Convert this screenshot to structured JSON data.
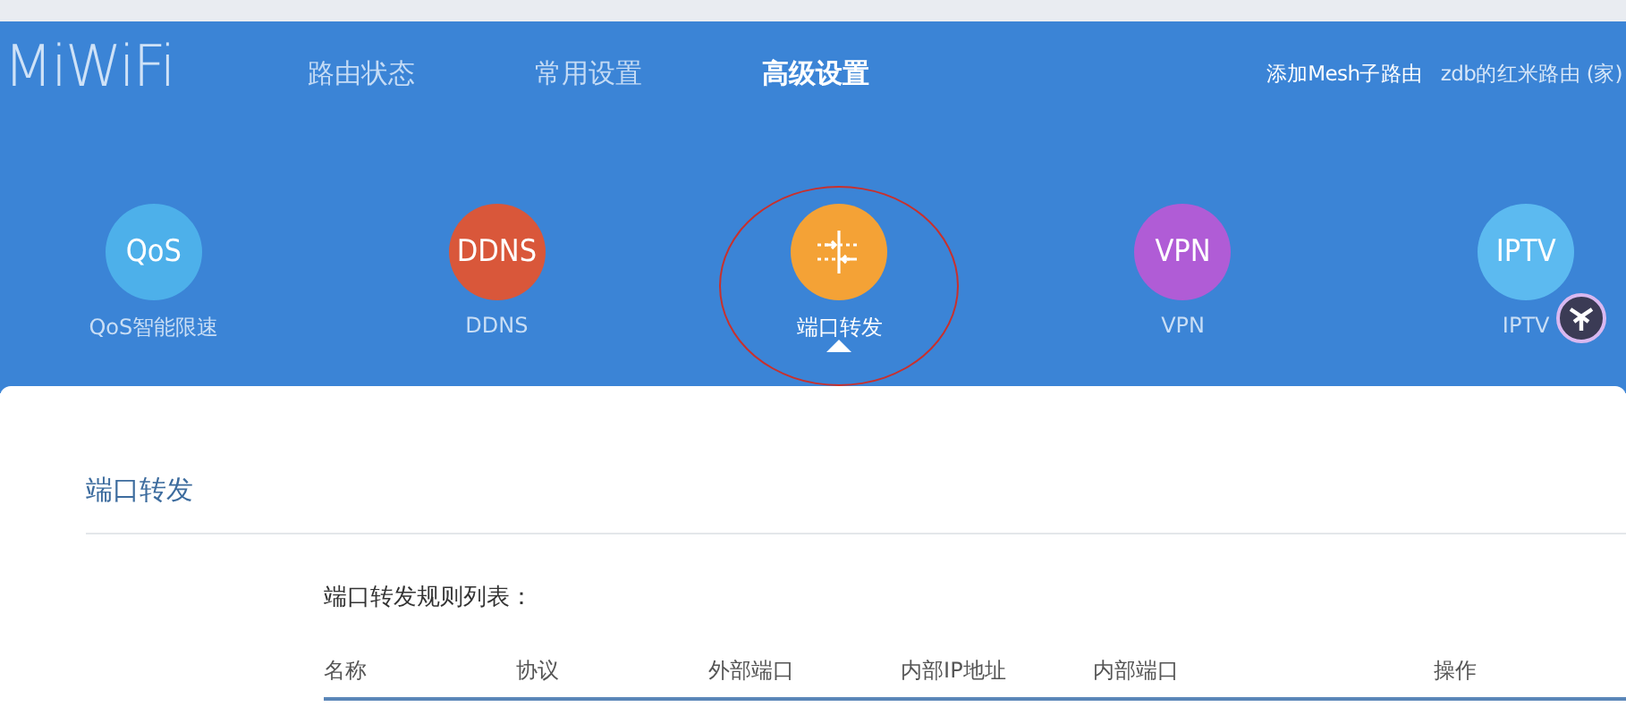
{
  "logo": "MiWiFi",
  "nav": [
    {
      "label": "路由状态",
      "selected": false
    },
    {
      "label": "常用设置",
      "selected": false
    },
    {
      "label": "高级设置",
      "selected": true
    }
  ],
  "header_links": [
    {
      "label": "添加Mesh子路由",
      "kind": "action"
    },
    {
      "label": "zdb的红米路由 (家)",
      "kind": "account"
    }
  ],
  "features": [
    {
      "kind": "text",
      "badge": "QoS",
      "label": "QoS智能限速",
      "color": "#4db0ea",
      "selected": false
    },
    {
      "kind": "text",
      "badge": "DDNS",
      "label": "DDNS",
      "color": "#d9573a",
      "selected": false
    },
    {
      "kind": "port-icon",
      "label": "端口转发",
      "color": "#f4a236",
      "selected": true
    },
    {
      "kind": "text",
      "badge": "VPN",
      "label": "VPN",
      "color": "#b05cd6",
      "selected": false
    },
    {
      "kind": "text",
      "badge": "IPTV",
      "label": "IPTV",
      "color": "#5cbaf0",
      "selected": false
    }
  ],
  "section": {
    "title": "端口转发",
    "subtitle": "端口转发规则列表：",
    "columns": [
      "名称",
      "协议",
      "外部端口",
      "内部IP地址",
      "内部端口",
      "操作"
    ]
  }
}
